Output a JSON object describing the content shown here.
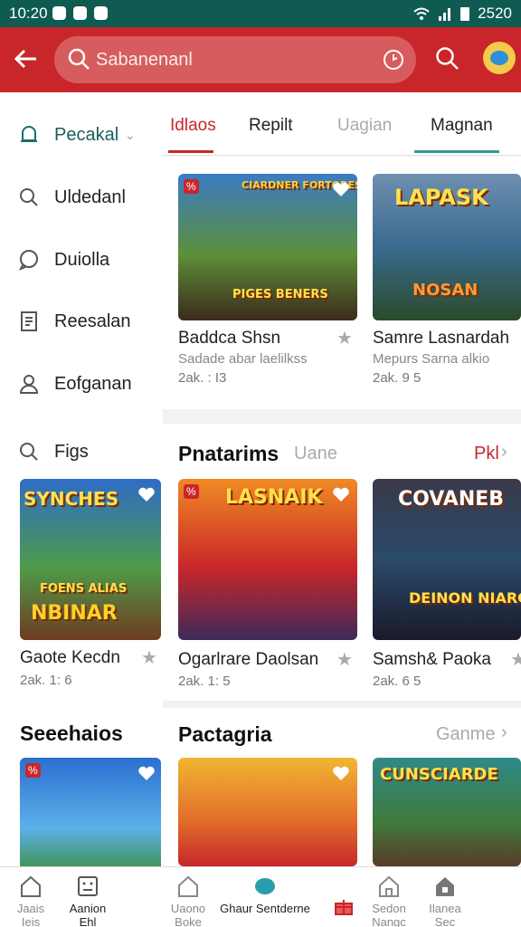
{
  "status_bar": {
    "time": "10:20",
    "right_text": "2520"
  },
  "search": {
    "placeholder": "Sabanenanl"
  },
  "sidebar": {
    "items": [
      {
        "label": "Pecakal",
        "icon": "bell-icon"
      },
      {
        "label": "Uldedanl",
        "icon": "search-icon"
      },
      {
        "label": "Duiolla",
        "icon": "chat-icon"
      },
      {
        "label": "Reesalan",
        "icon": "document-icon"
      },
      {
        "label": "Eofganan",
        "icon": "user-icon"
      },
      {
        "label": "Figs",
        "icon": "search-icon"
      }
    ],
    "card": {
      "art_top": "SYNCHES",
      "art_mid": "FOENS ALIAS",
      "art_bottom": "NBINAR",
      "title": "Gaote Kecdn",
      "meta": "2ak. 1: 6"
    },
    "section_title": "Seeehaios"
  },
  "tabs": [
    {
      "label": "Idlaos"
    },
    {
      "label": "Repilt"
    },
    {
      "label": "Uagian"
    },
    {
      "label": "Magnan"
    }
  ],
  "row1": [
    {
      "art_top": "CIARDNER FORTORES",
      "art_bottom": "PIGES BENERS",
      "title": "Baddca Shsn",
      "subtitle": "Sadade abar laelilkss",
      "meta": "2ak. : I3"
    },
    {
      "art_top": "LAPASK",
      "art_bottom": "NOSAN",
      "title": "Samre Lasnardah",
      "subtitle": "Mepurs Sarna alkio",
      "meta": "2ak. 9 5"
    }
  ],
  "section2": {
    "title": "Pnatarims",
    "subtitle": "Uane",
    "link": "Pkl",
    "cards": [
      {
        "art_top": "LASNAIK",
        "title": "Ogarlrare Daolsan",
        "meta": "2ak. 1: 5"
      },
      {
        "art_top": "COVANEB",
        "art_bottom": "DEINON NIARGS",
        "title": "Samsh& Paoka",
        "meta": "2ak. 6 5"
      }
    ]
  },
  "section3": {
    "title": "Pactagria",
    "link": "Ganme",
    "cards": [
      {
        "art_top": ""
      },
      {
        "art_top": "CUNSCIARDE"
      }
    ]
  },
  "bottom_nav": [
    {
      "label1": "Jaais",
      "label2": "Ieis"
    },
    {
      "label1": "Aanion",
      "label2": "Ehl"
    },
    {
      "label1": "Uaono",
      "label2": "Boke"
    },
    {
      "label1": "Ghaur Sentderne",
      "label2": ""
    },
    {
      "label1": "",
      "label2": ""
    },
    {
      "label1": "Sedon",
      "label2": "Nangc"
    },
    {
      "label1": "Ilanea",
      "label2": "Sec"
    }
  ],
  "colors": {
    "brand": "#c8262a",
    "status_bar": "#0f5b52",
    "accent_teal": "#2a9d9a"
  }
}
